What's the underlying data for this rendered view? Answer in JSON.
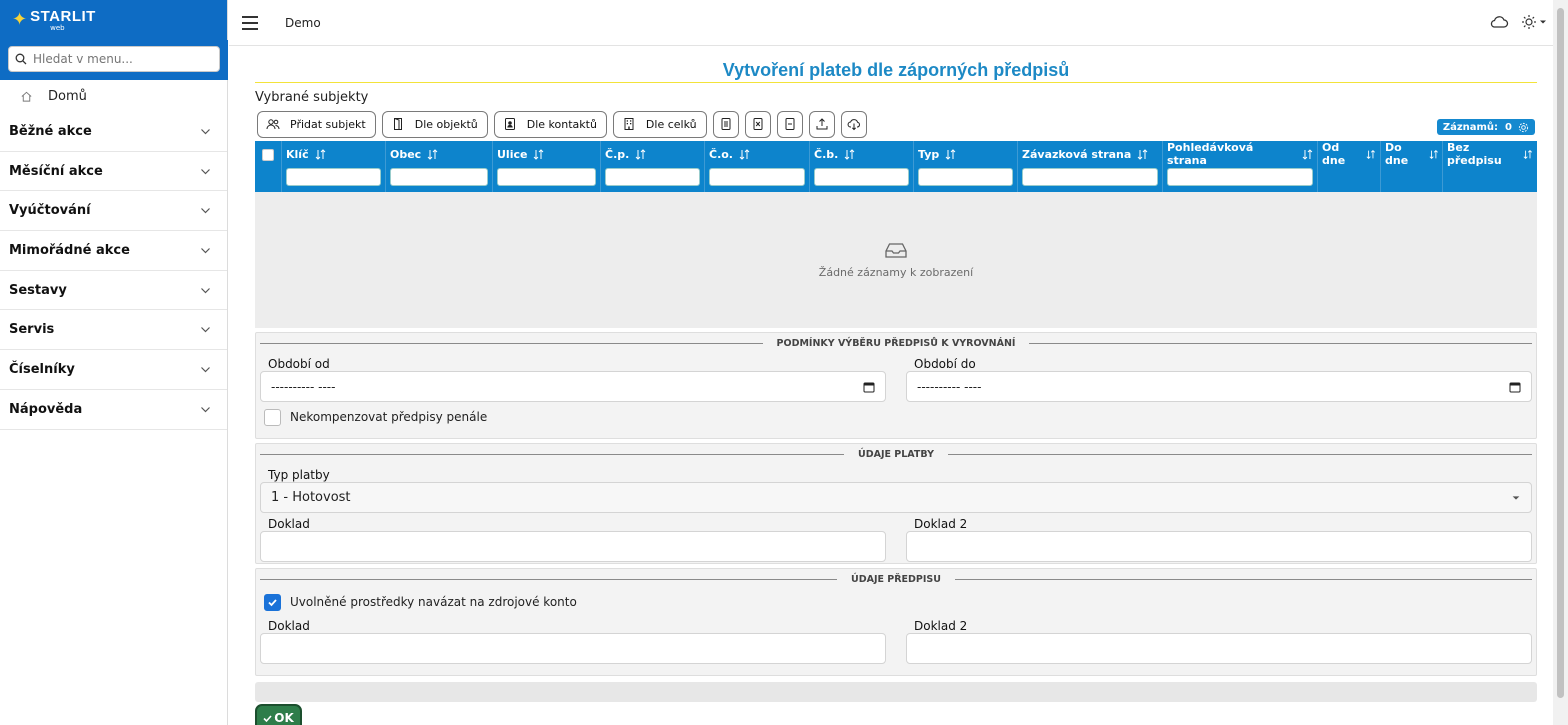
{
  "brand": {
    "name": "STARLIT",
    "sub": "web"
  },
  "search": {
    "placeholder": "Hledat v menu..."
  },
  "nav": {
    "home": "Domů",
    "items": [
      {
        "label": "Běžné akce"
      },
      {
        "label": "Měsíční akce"
      },
      {
        "label": "Vyúčtování"
      },
      {
        "label": "Mimořádné akce"
      },
      {
        "label": "Sestavy"
      },
      {
        "label": "Servis"
      },
      {
        "label": "Číselníky"
      },
      {
        "label": "Nápověda"
      }
    ]
  },
  "topbar": {
    "title": "Demo"
  },
  "page": {
    "title": "Vytvoření plateb dle záporných předpisů",
    "subtitle": "Vybrané subjekty"
  },
  "toolbar": {
    "add_subject": "Přidat subjekt",
    "by_objects": "Dle objektů",
    "by_contacts": "Dle kontaktů",
    "by_units": "Dle celků",
    "records_label": "Záznamů:",
    "records_count": "0"
  },
  "grid": {
    "columns": [
      "Klíč",
      "Obec",
      "Ulice",
      "Č.p.",
      "Č.o.",
      "Č.b.",
      "Typ",
      "Závazková strana",
      "Pohledávková strana",
      "Od dne",
      "Do dne",
      "Bez předpisu"
    ],
    "empty_text": "Žádné záznamy k zobrazení"
  },
  "section_conditions": {
    "legend": "PODMÍNKY VÝBĚRU PŘEDPISŮ K VYROVNÁNÍ",
    "period_from_label": "Období od",
    "period_from_value": "---------- ----",
    "period_to_label": "Období do",
    "period_to_value": "---------- ----",
    "no_compensate_label": "Nekompenzovat předpisy penále"
  },
  "section_payment": {
    "legend": "ÚDAJE PLATBY",
    "type_label": "Typ platby",
    "type_value": "1 - Hotovost",
    "doc_label": "Doklad",
    "doc2_label": "Doklad 2"
  },
  "section_prescription": {
    "legend": "ÚDAJE PŘEDPISU",
    "link_funds_label": "Uvolněné prostředky navázat na zdrojové konto",
    "doc_label": "Doklad",
    "doc2_label": "Doklad 2"
  },
  "ok_button": "OK",
  "colors": {
    "brand": "#0e6cc4",
    "accent": "#1d89c5",
    "grid_header": "#0d84cc",
    "ok": "#2e7d4a"
  }
}
